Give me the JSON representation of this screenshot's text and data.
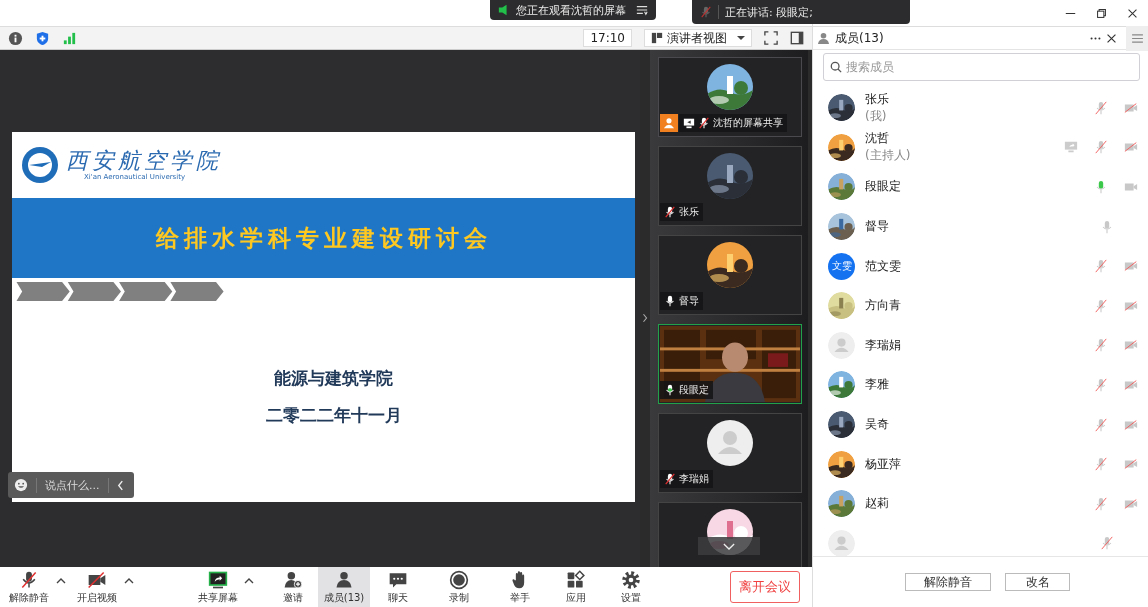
{
  "top_bar": {
    "viewing_notice": "您正在观看沈哲的屏幕",
    "speaking_notice": "正在讲话: 段眼定;"
  },
  "toolbar": {
    "time": "17:10",
    "view_mode": "演讲者视图"
  },
  "slide": {
    "logo_cn": "西安航空学院",
    "logo_en": "Xi'an Aeronautical University",
    "title": "给排水学科专业建设研讨会",
    "lines": [
      "能源与建筑学院",
      "二零二二年十一月"
    ]
  },
  "chat_input": {
    "placeholder": "说点什么..."
  },
  "thumbnails": [
    {
      "label": "沈哲的屏幕共享",
      "mic": {
        "muted": true,
        "speaking": false
      },
      "kind": "avatar",
      "host": true,
      "sharing": true,
      "active": false
    },
    {
      "label": "张乐",
      "mic": {
        "muted": true,
        "speaking": false
      },
      "kind": "avatar",
      "host": false,
      "sharing": false,
      "active": false
    },
    {
      "label": "督导",
      "mic": {
        "muted": false,
        "speaking": false
      },
      "kind": "avatar",
      "host": false,
      "sharing": false,
      "active": false
    },
    {
      "label": "段眼定",
      "mic": {
        "muted": false,
        "speaking": true
      },
      "kind": "video",
      "host": false,
      "sharing": false,
      "active": true
    },
    {
      "label": "李瑞娟",
      "mic": {
        "muted": true,
        "speaking": false
      },
      "kind": "default",
      "host": false,
      "sharing": false,
      "active": false
    },
    {
      "kind": "avatar",
      "host": false,
      "sharing": false,
      "active": false
    }
  ],
  "members": {
    "title": "成员(13)",
    "search_placeholder": "搜索成员",
    "list": [
      {
        "name": "张乐",
        "role": "(我)",
        "mic": {
          "muted": true,
          "speaking": false
        },
        "camera": {
          "off": true
        },
        "sharing": false
      },
      {
        "name": "沈哲",
        "role": "(主持人)",
        "mic": {
          "muted": true,
          "speaking": false
        },
        "camera": {
          "off": true
        },
        "sharing": true
      },
      {
        "name": "段眼定",
        "mic": {
          "muted": false,
          "speaking": true
        },
        "camera": {
          "off": false
        },
        "sharing": false
      },
      {
        "name": "督导",
        "mic": {
          "muted": false,
          "speaking": false
        },
        "sharing": false
      },
      {
        "name": "范文雯",
        "avatar": {
          "kind": "initials",
          "text": "文雯"
        },
        "mic": {
          "muted": true,
          "speaking": false
        },
        "camera": {
          "off": true
        },
        "sharing": false
      },
      {
        "name": "方向青",
        "mic": {
          "muted": true,
          "speaking": false
        },
        "camera": {
          "off": true
        },
        "sharing": false
      },
      {
        "name": "李瑞娟",
        "avatar": {
          "kind": "default"
        },
        "mic": {
          "muted": true,
          "speaking": false
        },
        "camera": {
          "off": true
        },
        "sharing": false
      },
      {
        "name": "李雅",
        "mic": {
          "muted": true,
          "speaking": false
        },
        "camera": {
          "off": true
        },
        "sharing": false
      },
      {
        "name": "吴奇",
        "mic": {
          "muted": true,
          "speaking": false
        },
        "camera": {
          "off": true
        },
        "sharing": false
      },
      {
        "name": "杨亚萍",
        "mic": {
          "muted": true,
          "speaking": false
        },
        "camera": {
          "off": true
        },
        "sharing": false
      },
      {
        "name": "赵莉",
        "mic": {
          "muted": true,
          "speaking": false
        },
        "camera": {
          "off": true
        },
        "sharing": false
      },
      {
        "avatar": {
          "kind": "default"
        },
        "mic": {
          "muted": true,
          "speaking": false
        },
        "sharing": false
      }
    ],
    "buttons": [
      "解除静音",
      "改名"
    ]
  },
  "controls": [
    {
      "kind": "mic",
      "label": "解除静音",
      "caret": true,
      "selected": false
    },
    {
      "kind": "video",
      "label": "开启视频",
      "caret": true,
      "selected": false
    },
    {
      "kind": "share",
      "label": "共享屏幕",
      "caret": true,
      "selected": false
    },
    {
      "kind": "invite",
      "label": "邀请",
      "caret": false,
      "selected": false
    },
    {
      "kind": "members",
      "label": "成员(13)",
      "caret": false,
      "selected": true
    },
    {
      "kind": "chat",
      "label": "聊天",
      "caret": false,
      "selected": false
    },
    {
      "kind": "record",
      "label": "录制",
      "caret": false,
      "selected": false
    },
    {
      "kind": "hand",
      "label": "举手",
      "caret": false,
      "selected": false
    },
    {
      "kind": "apps",
      "label": "应用",
      "caret": false,
      "selected": false
    },
    {
      "kind": "settings",
      "label": "设置",
      "caret": false,
      "selected": false
    }
  ],
  "leave_button": "离开会议"
}
